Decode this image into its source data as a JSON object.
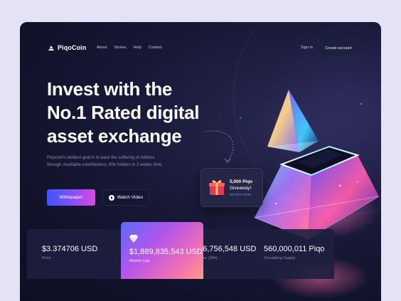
{
  "brand": {
    "name": "PiqoCoin"
  },
  "nav": {
    "links": [
      "About",
      "Stories",
      "Help",
      "Contact"
    ],
    "signin": "Sign in",
    "create_account": "Create account"
  },
  "hero": {
    "headline": [
      "Invest with the",
      "No.1 Rated digital",
      "asset exchange"
    ],
    "subtext": [
      "Piqocoin's boldest goal is to ease the suffering of millions",
      "through charitable contributions, 80k holders in 2 weeks time."
    ],
    "whitepaper_label": "Whitepaper",
    "video_label": "Watch Video"
  },
  "giveaway": {
    "amount": "5,000 Piqo",
    "title": "Giveaway!",
    "cta": "ENTER NOW"
  },
  "stats": [
    {
      "value": "$3.374706 USD",
      "label": "Price"
    },
    {
      "value": "$1,889,835,543 USD",
      "label": "Market Cap"
    },
    {
      "value": "$16,756,548 USD",
      "label": "Volume (24h)"
    },
    {
      "value": "560,000,011 Piqo",
      "label": "Circulating Supply"
    }
  ],
  "colors": {
    "page_bg": "#e4e3f5",
    "hero_bg": "#11122a",
    "accent_blue": "#3f56ff",
    "accent_pink": "#d94bd8",
    "muted_text": "#8d8fb5"
  },
  "icons": [
    "logo-mark-icon",
    "play-icon",
    "gift-icon",
    "diamond-icon",
    "curved-arrow-icon"
  ]
}
